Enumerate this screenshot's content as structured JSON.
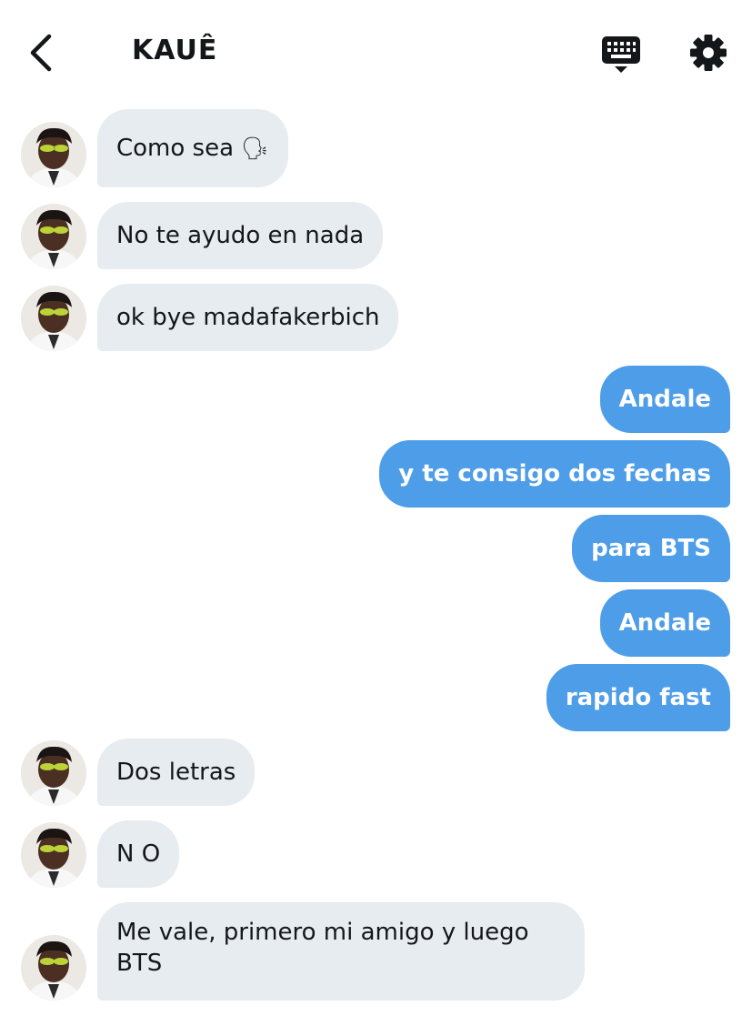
{
  "header": {
    "title": "KAUÊ"
  },
  "messages": [
    {
      "side": "in",
      "text": "Como sea",
      "emoji": "🗣"
    },
    {
      "side": "in",
      "text": "No te ayudo en nada"
    },
    {
      "side": "in",
      "text": "ok bye madafakerbich"
    },
    {
      "side": "out",
      "text": "Andale"
    },
    {
      "side": "out",
      "text": "y te consigo dos fechas"
    },
    {
      "side": "out",
      "text": "para BTS"
    },
    {
      "side": "out",
      "text": "Andale"
    },
    {
      "side": "out",
      "text": "rapido fast"
    },
    {
      "side": "in",
      "text": "Dos letras"
    },
    {
      "side": "in",
      "text": "N O"
    },
    {
      "side": "in",
      "text": "Me vale, primero mi amigo y luego BTS"
    }
  ],
  "colors": {
    "incoming_bubble": "#e6ecf0",
    "outgoing_bubble": "#4d9de8",
    "text_dark": "#14171a"
  },
  "icons": [
    "chevron-left-icon",
    "keyboard-icon",
    "gear-icon"
  ]
}
